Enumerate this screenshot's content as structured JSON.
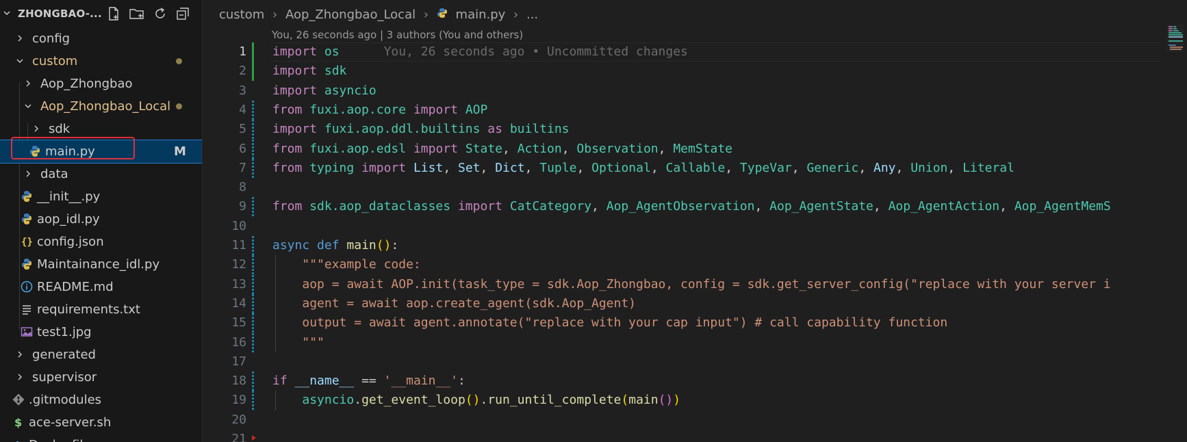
{
  "explorer": {
    "title": "ZHONGBAO-...",
    "tree": [
      {
        "label": "config",
        "type": "folder",
        "expanded": false,
        "indent": 1
      },
      {
        "label": "custom",
        "type": "folder",
        "expanded": true,
        "indent": 1,
        "modified": true
      },
      {
        "label": "Aop_Zhongbao",
        "type": "folder",
        "expanded": false,
        "indent": 2
      },
      {
        "label": "Aop_Zhongbao_Local",
        "type": "folder",
        "expanded": true,
        "indent": 2,
        "modified": true
      },
      {
        "label": "sdk",
        "type": "folder",
        "expanded": false,
        "indent": 3
      },
      {
        "label": "main.py",
        "type": "python",
        "indent": 3,
        "selected": true,
        "badge": "M"
      },
      {
        "label": "data",
        "type": "folder",
        "expanded": false,
        "indent": 2
      },
      {
        "label": "__init__.py",
        "type": "python",
        "indent": 2
      },
      {
        "label": "aop_idl.py",
        "type": "python",
        "indent": 2
      },
      {
        "label": "config.json",
        "type": "json",
        "indent": 2
      },
      {
        "label": "Maintainance_idl.py",
        "type": "python",
        "indent": 2
      },
      {
        "label": "README.md",
        "type": "info",
        "indent": 2
      },
      {
        "label": "requirements.txt",
        "type": "text",
        "indent": 2
      },
      {
        "label": "test1.jpg",
        "type": "image",
        "indent": 2
      },
      {
        "label": "generated",
        "type": "folder",
        "expanded": false,
        "indent": 1
      },
      {
        "label": "supervisor",
        "type": "folder",
        "expanded": false,
        "indent": 1
      },
      {
        "label": ".gitmodules",
        "type": "git",
        "indent": 1
      },
      {
        "label": "ace-server.sh",
        "type": "shell",
        "indent": 1
      },
      {
        "label": "Dockerfile",
        "type": "docker",
        "indent": 1
      }
    ]
  },
  "breadcrumb": {
    "items": [
      "custom",
      "Aop_Zhongbao_Local",
      "main.py",
      "..."
    ]
  },
  "blame_header": "You, 26 seconds ago | 3 authors (You and others)",
  "editor": {
    "active_line": 1,
    "inline_blame": "You, 26 seconds ago • Uncommitted changes",
    "lines": [
      {
        "n": "1",
        "gutter": "add",
        "tokens": [
          [
            "k",
            "import"
          ],
          [
            "p",
            " "
          ],
          [
            "m",
            "os"
          ]
        ]
      },
      {
        "n": "2",
        "gutter": "add",
        "tokens": [
          [
            "k",
            "import"
          ],
          [
            "p",
            " "
          ],
          [
            "m",
            "sdk"
          ]
        ]
      },
      {
        "n": "3",
        "gutter": "",
        "tokens": [
          [
            "k",
            "import"
          ],
          [
            "p",
            " "
          ],
          [
            "m",
            "asyncio"
          ]
        ]
      },
      {
        "n": "4",
        "gutter": "mod",
        "tokens": [
          [
            "k",
            "from"
          ],
          [
            "p",
            " "
          ],
          [
            "m",
            "fuxi.aop.core"
          ],
          [
            "p",
            " "
          ],
          [
            "k",
            "import"
          ],
          [
            "p",
            " "
          ],
          [
            "m",
            "AOP"
          ]
        ]
      },
      {
        "n": "5",
        "gutter": "mod",
        "tokens": [
          [
            "k",
            "import"
          ],
          [
            "p",
            " "
          ],
          [
            "m",
            "fuxi.aop.ddl.builtins"
          ],
          [
            "p",
            " "
          ],
          [
            "k",
            "as"
          ],
          [
            "p",
            " "
          ],
          [
            "m",
            "builtins"
          ]
        ]
      },
      {
        "n": "6",
        "gutter": "mod",
        "tokens": [
          [
            "k",
            "from"
          ],
          [
            "p",
            " "
          ],
          [
            "m",
            "fuxi.aop.edsl"
          ],
          [
            "p",
            " "
          ],
          [
            "k",
            "import"
          ],
          [
            "p",
            " "
          ],
          [
            "m",
            "State"
          ],
          [
            "p",
            ", "
          ],
          [
            "m",
            "Action"
          ],
          [
            "p",
            ", "
          ],
          [
            "m",
            "Observation"
          ],
          [
            "p",
            ", "
          ],
          [
            "m",
            "MemState"
          ]
        ]
      },
      {
        "n": "7",
        "gutter": "mod",
        "tokens": [
          [
            "k",
            "from"
          ],
          [
            "p",
            " "
          ],
          [
            "m",
            "typing"
          ],
          [
            "p",
            " "
          ],
          [
            "k",
            "import"
          ],
          [
            "p",
            " "
          ],
          [
            "v",
            "List"
          ],
          [
            "p",
            ", "
          ],
          [
            "v",
            "Set"
          ],
          [
            "p",
            ", "
          ],
          [
            "v",
            "Dict"
          ],
          [
            "p",
            ", "
          ],
          [
            "m",
            "Tuple"
          ],
          [
            "p",
            ", "
          ],
          [
            "m",
            "Optional"
          ],
          [
            "p",
            ", "
          ],
          [
            "m",
            "Callable"
          ],
          [
            "p",
            ", "
          ],
          [
            "m",
            "TypeVar"
          ],
          [
            "p",
            ", "
          ],
          [
            "m",
            "Generic"
          ],
          [
            "p",
            ", "
          ],
          [
            "v",
            "Any"
          ],
          [
            "p",
            ", "
          ],
          [
            "m",
            "Union"
          ],
          [
            "p",
            ", "
          ],
          [
            "m",
            "Literal"
          ]
        ]
      },
      {
        "n": "8",
        "gutter": "",
        "tokens": []
      },
      {
        "n": "9",
        "gutter": "mod",
        "tokens": [
          [
            "k",
            "from"
          ],
          [
            "p",
            " "
          ],
          [
            "m",
            "sdk.aop_dataclasses"
          ],
          [
            "p",
            " "
          ],
          [
            "k",
            "import"
          ],
          [
            "p",
            " "
          ],
          [
            "m",
            "CatCategory"
          ],
          [
            "p",
            ", "
          ],
          [
            "m",
            "Aop_AgentObservation"
          ],
          [
            "p",
            ", "
          ],
          [
            "m",
            "Aop_AgentState"
          ],
          [
            "p",
            ", "
          ],
          [
            "m",
            "Aop_AgentAction"
          ],
          [
            "p",
            ", "
          ],
          [
            "m",
            "Aop_AgentMemS"
          ]
        ]
      },
      {
        "n": "10",
        "gutter": "",
        "tokens": []
      },
      {
        "n": "11",
        "gutter": "mod",
        "tokens": [
          [
            "kb",
            "async"
          ],
          [
            "p",
            " "
          ],
          [
            "kb",
            "def"
          ],
          [
            "p",
            " "
          ],
          [
            "f",
            "main"
          ],
          [
            "y",
            "()"
          ],
          [
            "p",
            ":"
          ]
        ]
      },
      {
        "n": "12",
        "gutter": "mod",
        "tokens": [
          [
            "p",
            "    "
          ],
          [
            "s",
            "\"\"\"example code:"
          ]
        ]
      },
      {
        "n": "13",
        "gutter": "mod",
        "tokens": [
          [
            "p",
            "    "
          ],
          [
            "s",
            "aop = await AOP.init(task_type = sdk.Aop_Zhongbao, config = sdk.get_server_config(\"replace with your server i"
          ]
        ]
      },
      {
        "n": "14",
        "gutter": "mod",
        "tokens": [
          [
            "p",
            "    "
          ],
          [
            "s",
            "agent = await aop.create_agent(sdk.Aop_Agent)"
          ]
        ]
      },
      {
        "n": "15",
        "gutter": "mod",
        "tokens": [
          [
            "p",
            "    "
          ],
          [
            "s",
            "output = await agent.annotate(\"replace with your cap input\") # call capability function"
          ]
        ]
      },
      {
        "n": "16",
        "gutter": "mod",
        "tokens": [
          [
            "p",
            "    "
          ],
          [
            "s",
            "\"\"\""
          ]
        ]
      },
      {
        "n": "17",
        "gutter": "",
        "tokens": []
      },
      {
        "n": "18",
        "gutter": "mod",
        "tokens": [
          [
            "k",
            "if"
          ],
          [
            "p",
            " "
          ],
          [
            "v",
            "__name__"
          ],
          [
            "p",
            " == "
          ],
          [
            "s",
            "'__main__'"
          ],
          [
            "p",
            ":"
          ]
        ]
      },
      {
        "n": "19",
        "gutter": "mod",
        "tokens": [
          [
            "p",
            "    "
          ],
          [
            "m",
            "asyncio"
          ],
          [
            "p",
            "."
          ],
          [
            "f",
            "get_event_loop"
          ],
          [
            "y",
            "()"
          ],
          [
            "p",
            "."
          ],
          [
            "f",
            "run_until_complete"
          ],
          [
            "y",
            "("
          ],
          [
            "f",
            "main"
          ],
          [
            "pk",
            "()"
          ],
          [
            "y",
            ")"
          ]
        ]
      },
      {
        "n": "20",
        "gutter": "",
        "tokens": []
      },
      {
        "n": "21",
        "gutter": "",
        "tokens": []
      }
    ]
  }
}
